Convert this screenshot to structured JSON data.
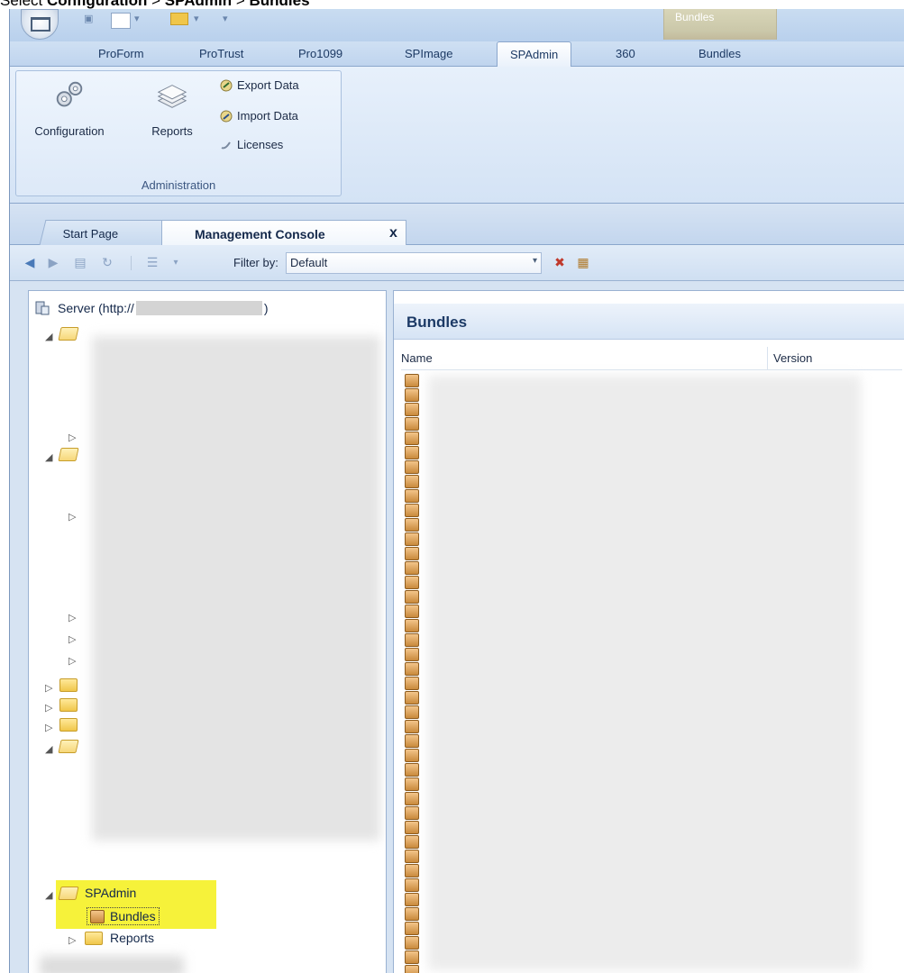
{
  "caption": {
    "prefix": "Select ",
    "part1": "Configuration",
    "sep1": " > ",
    "part2": "SPAdmin",
    "sep2": " > ",
    "part3": "Bundles"
  },
  "contextual_tab": {
    "label": "Bundles"
  },
  "ribbon_tabs": [
    "ProForm",
    "ProTrust",
    "Pro1099",
    "SPImage",
    "SPAdmin",
    "360",
    "Bundles"
  ],
  "ribbon": {
    "group_label": "Administration",
    "configuration": "Configuration",
    "reports": "Reports",
    "export": "Export Data",
    "import": "Import Data",
    "licenses": "Licenses"
  },
  "doc_tabs": {
    "start": "Start Page",
    "mgmt": "Management Console",
    "close": "x"
  },
  "toolbar": {
    "filter_label": "Filter by:",
    "filter_value": "Default"
  },
  "tree": {
    "server": "Server (http://",
    "server_end": ")",
    "spadmin": "SPAdmin",
    "bundles": "Bundles",
    "reports": "Reports"
  },
  "bundles_pane": {
    "title": "Bundles",
    "col_name": "Name",
    "col_version": "Version"
  },
  "colors": {
    "ribbon_accent": "#8aa6cc",
    "highlight": "#f6f23a"
  },
  "icons": [
    "app-menu-icon",
    "save-icon",
    "new-icon",
    "folder-icon",
    "gears-icon",
    "reports-stack-icon",
    "export-icon",
    "import-icon",
    "licenses-icon",
    "back-icon",
    "forward-icon",
    "refresh-icon",
    "view-icon",
    "delete-icon",
    "properties-icon",
    "server-icon",
    "bundle-icon"
  ]
}
